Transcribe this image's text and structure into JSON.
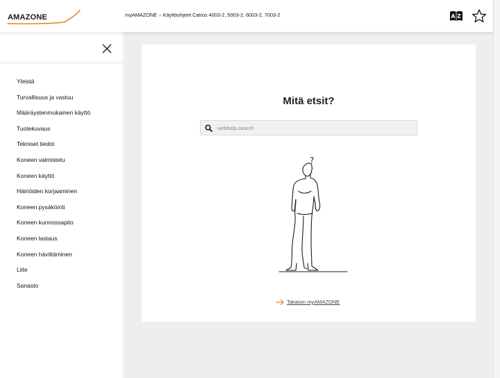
{
  "header": {
    "logo_text": "AMAZONE",
    "breadcrumb": {
      "home": "myAMAZONE",
      "separator": "›",
      "current": "Käyttöohjeet Catros 4003-2, 5003-2, 6003-2, 7003-2"
    },
    "icons": [
      "glossary-az-icon",
      "star-icon"
    ]
  },
  "sidebar": {
    "items": [
      {
        "label": "Yleistä"
      },
      {
        "label": "Turvallisuus ja vastuu"
      },
      {
        "label": "Määräystenmukainen käyttö"
      },
      {
        "label": "Tuotekuvaus"
      },
      {
        "label": "Tekniset tiedot"
      },
      {
        "label": "Koneen valmistelu"
      },
      {
        "label": "Koneen käyttö"
      },
      {
        "label": "Häiriöiden korjaaminen"
      },
      {
        "label": "Koneen pysäköinti"
      },
      {
        "label": "Koneen kunnossapito"
      },
      {
        "label": "Koneen lastaus"
      },
      {
        "label": "Koneen hävittäminen"
      },
      {
        "label": "Liite"
      },
      {
        "label": "Sanasto"
      }
    ]
  },
  "main": {
    "heading": "Mitä etsit?",
    "search": {
      "placeholder": "webhelp.search",
      "value": ""
    },
    "illustration_mark": "?",
    "back_link": "Takaisin myAMAZONE"
  },
  "colors": {
    "brand_orange": "#e8801e",
    "page_bg": "#eeeeee",
    "card_bg": "#ffffff"
  }
}
